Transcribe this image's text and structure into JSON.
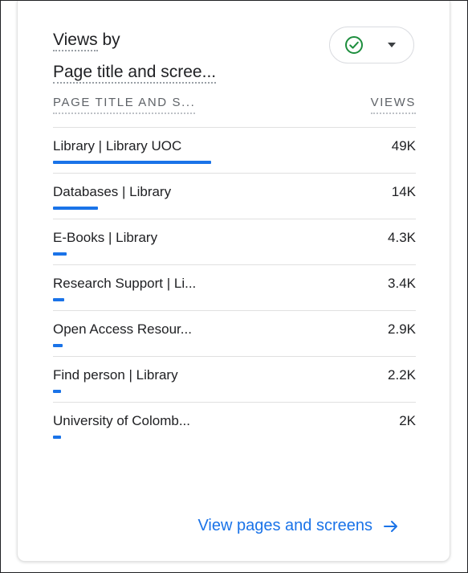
{
  "card": {
    "title_line1": "Views",
    "title_line1_suffix": " by",
    "title_line2": "Page title and scree...",
    "compare_icon": "check-circle-icon",
    "accent_color": "#1a73e8",
    "check_color": "#1e8e3e"
  },
  "table": {
    "col_dimension": "PAGE TITLE AND S...",
    "col_metric": "VIEWS",
    "rows": [
      {
        "label": "Library | Library UOC",
        "value": "49K",
        "share": 1.0
      },
      {
        "label": "Databases | Library",
        "value": "14K",
        "share": 0.286
      },
      {
        "label": "E-Books | Library",
        "value": "4.3K",
        "share": 0.088
      },
      {
        "label": "Research Support | Li...",
        "value": "3.4K",
        "share": 0.069
      },
      {
        "label": "Open Access Resour...",
        "value": "2.9K",
        "share": 0.059
      },
      {
        "label": "Find person | Library",
        "value": "2.2K",
        "share": 0.045
      },
      {
        "label": "University of Colomb...",
        "value": "2K",
        "share": 0.041
      }
    ]
  },
  "footer": {
    "link_label": "View pages and screens",
    "link_icon": "arrow-right-icon"
  }
}
